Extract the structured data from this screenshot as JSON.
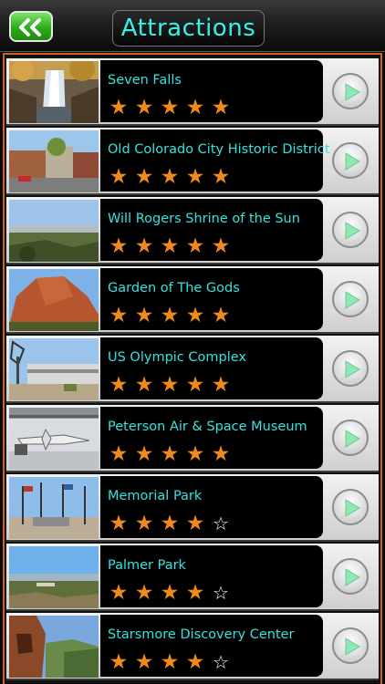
{
  "header": {
    "title": "Attractions",
    "back_icon": "double-chevron-left-icon"
  },
  "colors": {
    "accent": "#38f0e6",
    "star": "#f08a1c",
    "frame": "#d0631a",
    "back": "#2eab1b"
  },
  "attractions": [
    {
      "name": "Seven Falls",
      "rating": 5
    },
    {
      "name": "Old Colorado City Historic District",
      "rating": 5
    },
    {
      "name": "Will Rogers Shrine of the Sun",
      "rating": 5
    },
    {
      "name": "Garden of The Gods",
      "rating": 5
    },
    {
      "name": "US Olympic Complex",
      "rating": 5
    },
    {
      "name": "Peterson Air & Space Museum",
      "rating": 5
    },
    {
      "name": "Memorial Park",
      "rating": 4
    },
    {
      "name": "Palmer Park",
      "rating": 4
    },
    {
      "name": "Starsmore Discovery Center",
      "rating": 4
    }
  ]
}
